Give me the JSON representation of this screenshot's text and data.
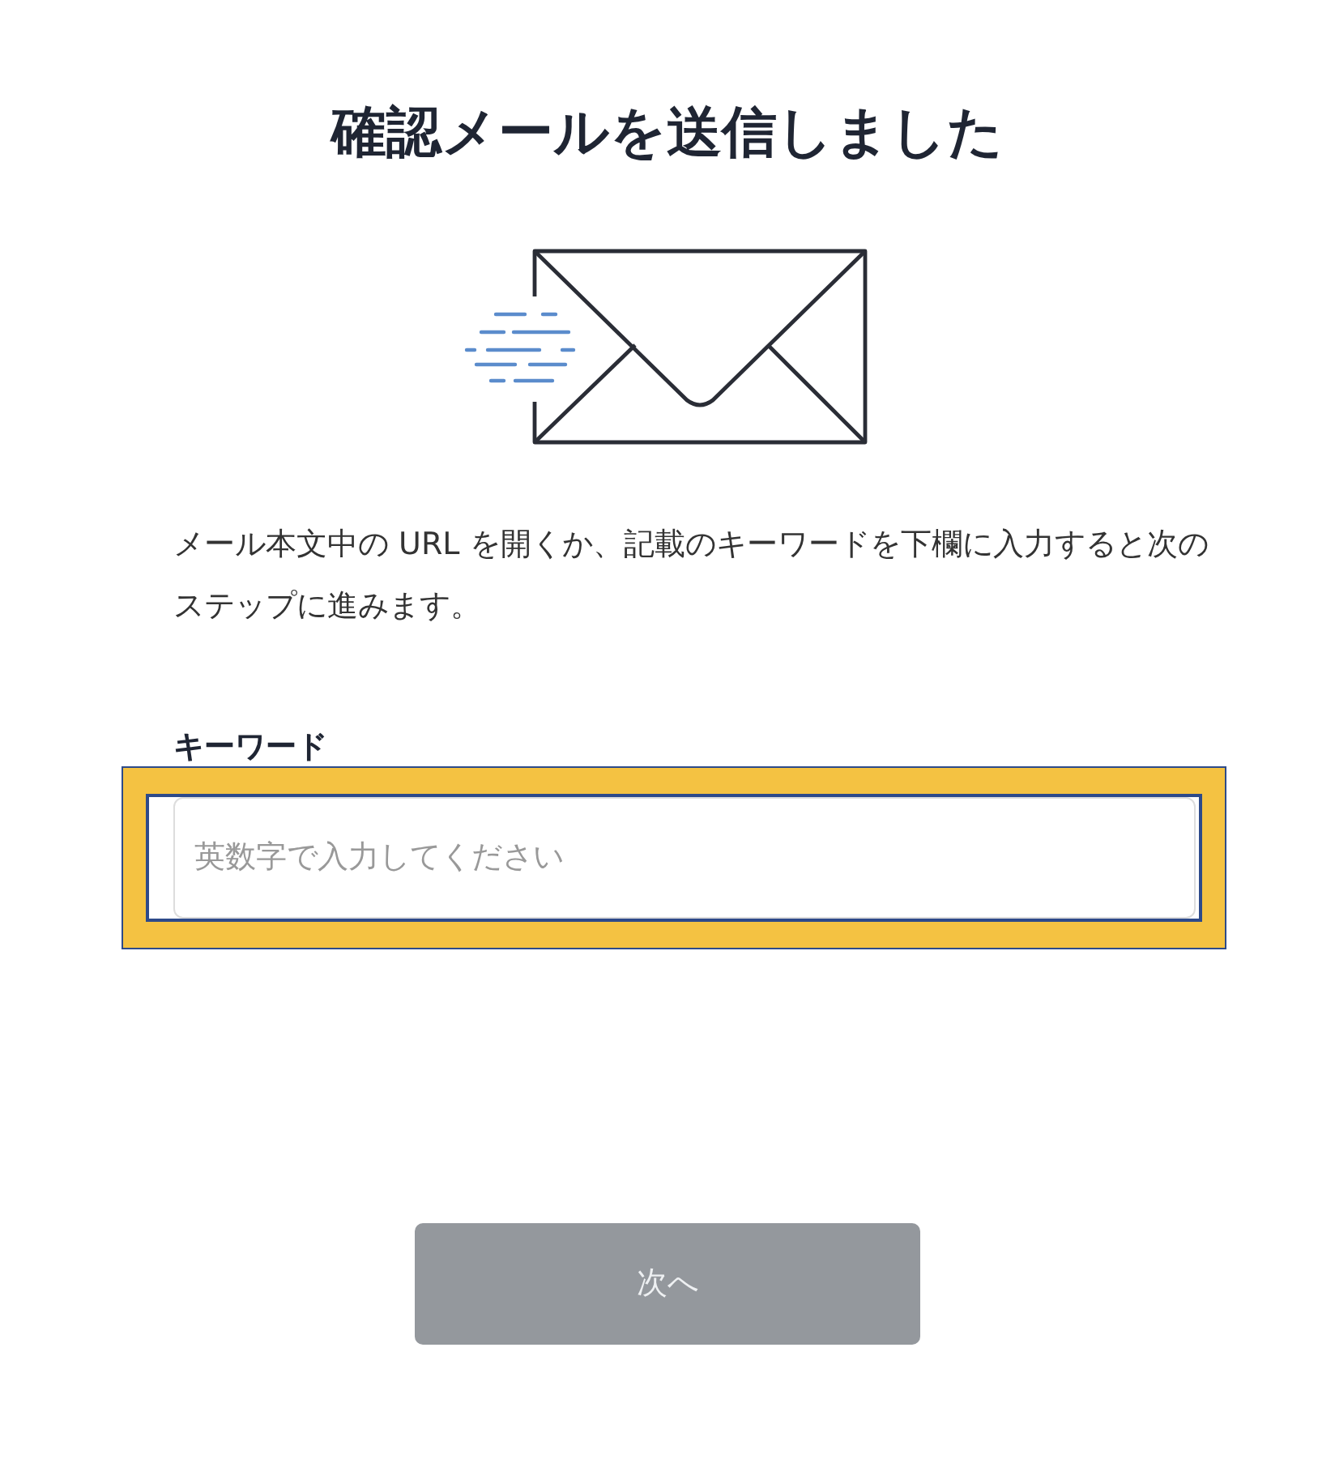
{
  "title": "確認メールを送信しました",
  "message": "メール本文中の URL を開くか、記載のキーワードを下欄に入力すると次のステップに進みます。",
  "keyword_field": {
    "label": "キーワード",
    "placeholder": "英数字で入力してください",
    "highlighted": true
  },
  "next_button": {
    "label": "次へ",
    "disabled": true
  }
}
